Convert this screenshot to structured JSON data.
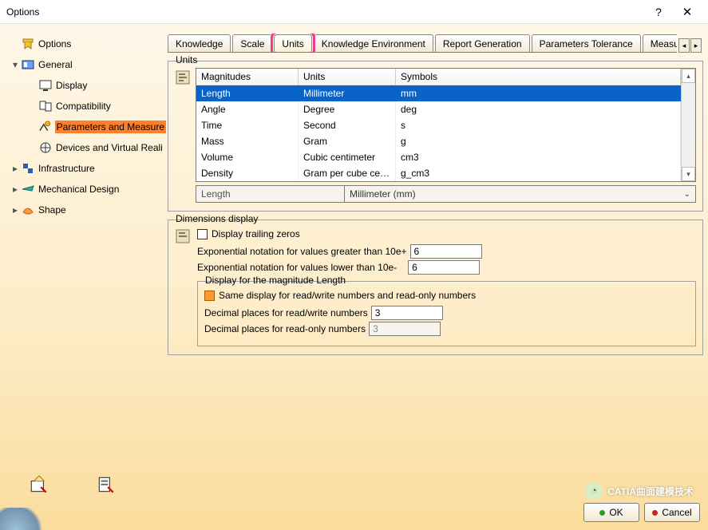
{
  "window": {
    "title": "Options",
    "help": "?",
    "close": "✕"
  },
  "tree": {
    "items": [
      {
        "label": "Options",
        "indent": 0,
        "tw": "",
        "icon": "options-icon",
        "sel": false
      },
      {
        "label": "General",
        "indent": 0,
        "tw": "▾",
        "icon": "general-icon",
        "sel": false
      },
      {
        "label": "Display",
        "indent": 1,
        "tw": "",
        "icon": "display-icon",
        "sel": false
      },
      {
        "label": "Compatibility",
        "indent": 1,
        "tw": "",
        "icon": "compat-icon",
        "sel": false
      },
      {
        "label": "Parameters and Measure",
        "indent": 1,
        "tw": "",
        "icon": "param-icon",
        "sel": true
      },
      {
        "label": "Devices and Virtual Reali",
        "indent": 1,
        "tw": "",
        "icon": "devices-icon",
        "sel": false
      },
      {
        "label": "Infrastructure",
        "indent": 0,
        "tw": "▸",
        "icon": "infra-icon",
        "sel": false
      },
      {
        "label": "Mechanical Design",
        "indent": 0,
        "tw": "▸",
        "icon": "mech-icon",
        "sel": false
      },
      {
        "label": "Shape",
        "indent": 0,
        "tw": "▸",
        "icon": "shape-icon",
        "sel": false
      }
    ]
  },
  "tabs": {
    "items": [
      "Knowledge",
      "Scale",
      "Units",
      "Knowledge Environment",
      "Report Generation",
      "Parameters Tolerance",
      "Measu"
    ],
    "active": 2,
    "highlight": 2
  },
  "units": {
    "legend": "Units",
    "headers": {
      "c1": "Magnitudes",
      "c2": "Units",
      "c3": "Symbols"
    },
    "rows": [
      {
        "m": "Length",
        "u": "Millimeter",
        "s": "mm",
        "sel": true
      },
      {
        "m": "Angle",
        "u": "Degree",
        "s": "deg",
        "sel": false
      },
      {
        "m": "Time",
        "u": "Second",
        "s": "s",
        "sel": false
      },
      {
        "m": "Mass",
        "u": "Gram",
        "s": "g",
        "sel": false
      },
      {
        "m": "Volume",
        "u": "Cubic centimeter",
        "s": "cm3",
        "sel": false
      },
      {
        "m": "Density",
        "u": "Gram per cube cen...",
        "s": "g_cm3",
        "sel": false
      }
    ],
    "sel_label": "Length",
    "sel_value": "Millimeter (mm)"
  },
  "dims": {
    "legend": "Dimensions display",
    "trailing": "Display trailing zeros",
    "exp_hi_label": "Exponential notation for values greater than 10e+",
    "exp_hi_val": "6",
    "exp_lo_label": "Exponential notation for values lower than 10e-",
    "exp_lo_val": "6",
    "mag_legend": "Display for the magnitude Length",
    "same_display": "Same display for read/write numbers and read-only numbers",
    "dec_rw_label": "Decimal places for read/write numbers",
    "dec_rw_val": "3",
    "dec_ro_label": "Decimal places for read-only numbers",
    "dec_ro_val": "3"
  },
  "buttons": {
    "ok": "OK",
    "cancel": "Cancel"
  },
  "watermark": "CATIA曲面建模技术"
}
